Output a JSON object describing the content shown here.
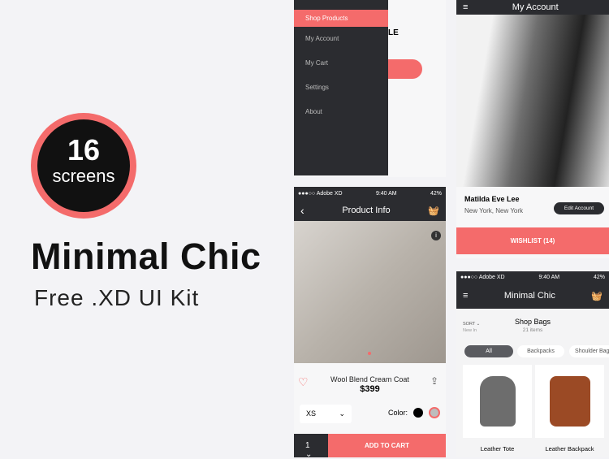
{
  "promo": {
    "count": "16",
    "count_label": "screens",
    "title": "Minimal Chic",
    "subtitle": "Free .XD UI Kit"
  },
  "menu_screen": {
    "items": [
      "Shop Products",
      "My Account",
      "My Cart",
      "Settings",
      "About"
    ],
    "partial_text": "LE"
  },
  "status": {
    "carrier": "●●●○○ Adobe XD",
    "time": "9:40 AM",
    "battery": "42%"
  },
  "product": {
    "nav_title": "Product Info",
    "name": "Wool Blend Cream Coat",
    "price": "$399",
    "size": "XS",
    "color_label": "Color:",
    "colors": [
      "#000000",
      "#bdbdbd"
    ],
    "qty": "1",
    "add_to_cart": "ADD TO CART"
  },
  "account": {
    "nav_title": "My Account",
    "name": "Matilda Eve Lee",
    "location": "New York, New York",
    "edit": "Edit Account",
    "wishlist": "WISHLIST (14)"
  },
  "shop": {
    "nav_title": "Minimal Chic",
    "sort": "SORT",
    "sort_value": "New In",
    "heading": "Shop Bags",
    "count": "21 items",
    "filters": [
      "All",
      "Backpacks",
      "Shoulder Bags"
    ],
    "products": [
      "Leather Tote",
      "Leather Backpack"
    ]
  },
  "colors": {
    "accent": "#f46b6b",
    "dark": "#2b2c30"
  }
}
